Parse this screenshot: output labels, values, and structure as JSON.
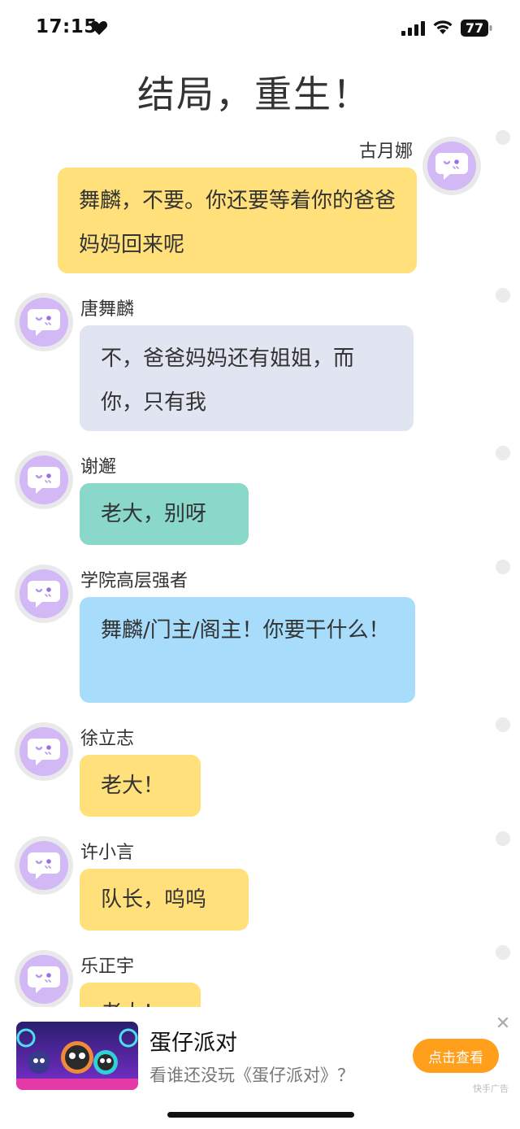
{
  "status": {
    "time": "17:15",
    "battery": "77",
    "icons": [
      "heart-icon",
      "signal-icon",
      "wifi-icon",
      "battery-icon"
    ]
  },
  "title": "结局，重生！",
  "messages": [
    {
      "name": "古月娜",
      "text": "舞麟，不要。你还要等着你的爸爸妈妈回来呢",
      "side": "right",
      "color": "yellow"
    },
    {
      "name": "唐舞麟",
      "text": "不，爸爸妈妈还有姐姐，而你，只有我",
      "side": "left",
      "color": "gray"
    },
    {
      "name": "谢邂",
      "text": "老大，别呀",
      "side": "left",
      "color": "teal"
    },
    {
      "name": "学院高层强者",
      "text": "舞麟/门主/阁主！你要干什么！",
      "side": "left",
      "color": "blue"
    },
    {
      "name": "徐立志",
      "text": "老大！",
      "side": "left",
      "color": "yellow"
    },
    {
      "name": "许小言",
      "text": "队长，呜呜",
      "side": "left",
      "color": "yellow"
    },
    {
      "name": "乐正宇",
      "text": "老大！",
      "side": "left",
      "color": "yellow"
    }
  ],
  "ad": {
    "title": "蛋仔派对",
    "desc": "看谁还没玩《蛋仔派对》？",
    "button": "点击查看",
    "tag": "快手广告",
    "close": "✕"
  }
}
